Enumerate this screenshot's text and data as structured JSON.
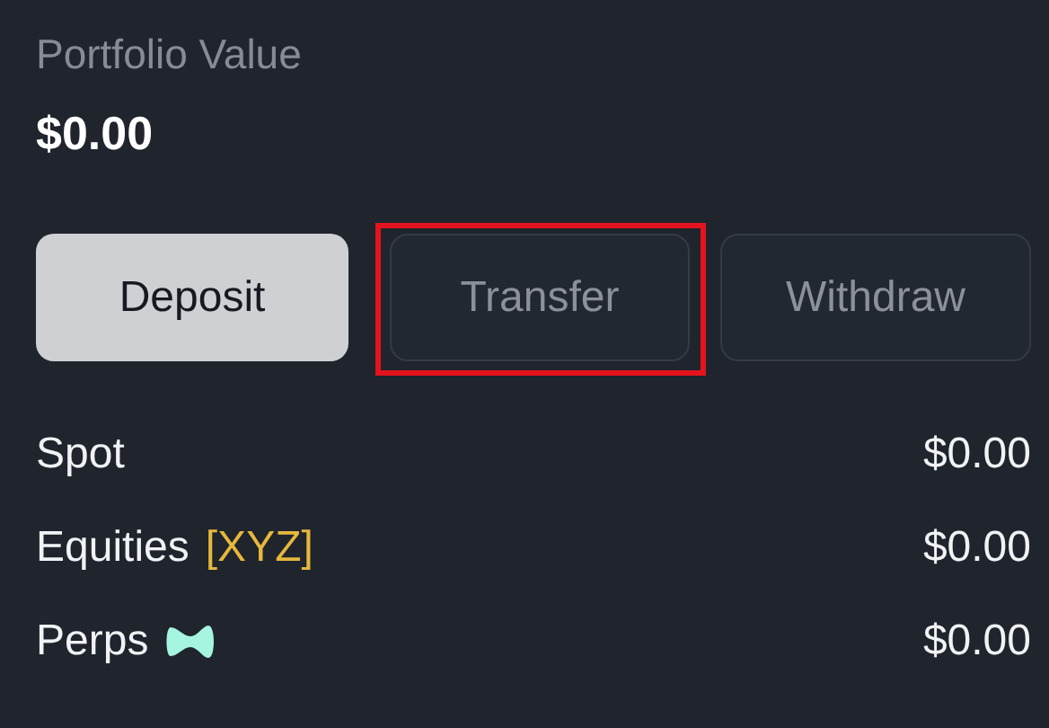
{
  "portfolio": {
    "label": "Portfolio Value",
    "value": "$0.00"
  },
  "buttons": [
    {
      "label": "Deposit",
      "kind": "primary",
      "highlighted": false
    },
    {
      "label": "Transfer",
      "kind": "secondary",
      "highlighted": true
    },
    {
      "label": "Withdraw",
      "kind": "secondary",
      "highlighted": false
    }
  ],
  "balances": [
    {
      "name": "Spot",
      "value": "$0.00"
    },
    {
      "name": "Equities",
      "tag": "[XYZ]",
      "value": "$0.00"
    },
    {
      "name": "Perps",
      "has_icon": true,
      "value": "$0.00"
    }
  ]
}
